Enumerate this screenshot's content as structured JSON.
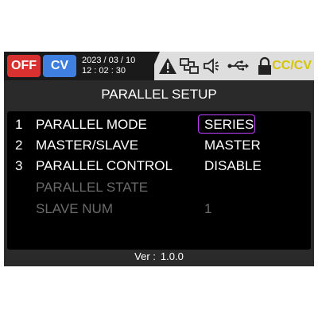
{
  "status": {
    "output_state": "OFF",
    "mode_badge": "CV",
    "date": "2023 / 03 / 10",
    "time": "12 : 02 : 30",
    "icons": [
      "warning-icon",
      "parallel-link-icon",
      "speaker-icon",
      "usb-icon",
      "lock-icon"
    ],
    "mode_text": "CC/CV",
    "colors": {
      "off": "#d9312f",
      "cv": "#3f7fe0",
      "mode_text": "#d6c400",
      "selection": "#c040ff"
    }
  },
  "page": {
    "title": "PARALLEL SETUP"
  },
  "settings": [
    {
      "index": "1",
      "label": "PARALLEL MODE",
      "value": "SERIES",
      "selected": true,
      "enabled": true
    },
    {
      "index": "2",
      "label": "MASTER/SLAVE",
      "value": "MASTER",
      "selected": false,
      "enabled": true
    },
    {
      "index": "3",
      "label": "PARALLEL CONTROL",
      "value": "DISABLE",
      "selected": false,
      "enabled": true
    },
    {
      "index": "",
      "label": "PARALLEL STATE",
      "value": "",
      "selected": false,
      "enabled": false
    },
    {
      "index": "",
      "label": "SLAVE NUM",
      "value": "1",
      "selected": false,
      "enabled": false
    }
  ],
  "footer": {
    "version_label": "Ver :",
    "version_value": "1.0.0"
  }
}
